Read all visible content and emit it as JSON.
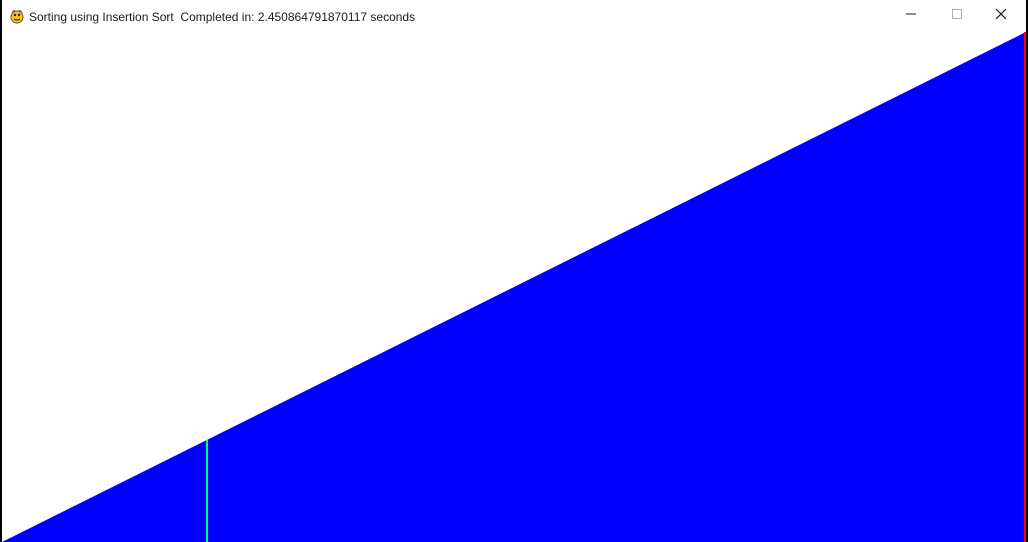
{
  "window": {
    "title_prefix": "Sorting using Insertion Sort",
    "completed_label": "Completed in:",
    "completed_value": "2.450864791870117",
    "completed_unit": "seconds",
    "app_icon": "pygame-snake-icon"
  },
  "controls": {
    "minimize_icon": "minimize-icon",
    "maximize_icon": "maximize-icon",
    "close_icon": "close-icon"
  },
  "visualization": {
    "bar_color": "#0000ff",
    "highlight_color": "#00ff66",
    "edge_color": "#ff0000",
    "background_color": "#ffffff",
    "state": "sorted-ascending",
    "highlight_fraction": 0.2,
    "edge_fraction": 1.0
  }
}
